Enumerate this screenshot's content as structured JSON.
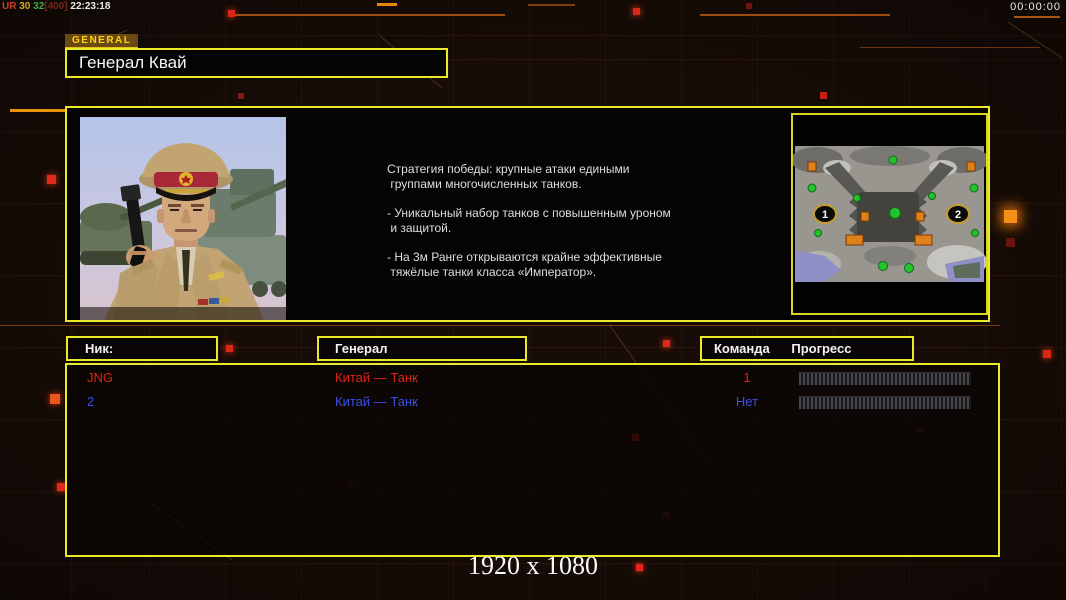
{
  "hud": {
    "debug_segments": [
      {
        "text": "UR ",
        "color": "#c83c28"
      },
      {
        "text": "30 ",
        "color": "#d8a828"
      },
      {
        "text": "32",
        "color": "#3fae3f"
      },
      {
        "text": "[400] ",
        "color": "#7a2418"
      },
      {
        "text": "22:23:18",
        "color": "#ececec"
      }
    ],
    "timer": "00:00:00"
  },
  "tab": {
    "label": "GENERAL"
  },
  "header": {
    "title": "Генерал Квай"
  },
  "info": {
    "description": [
      "Стратегия победы: крупные атаки едиными\n группами многочисленных танков.",
      "- Уникальный набор танков с повышенным уроном\n и защитой.",
      "- На 3м Ранге открываются крайне эффективные\n тяжёлые танки класса «Император»."
    ],
    "minimap": {
      "start_positions": [
        "1",
        "2"
      ]
    }
  },
  "table": {
    "headers": {
      "nick": "Ник:",
      "general": "Генерал",
      "team": "Команда",
      "progress": "Прогресс"
    },
    "rows": [
      {
        "nick": "JNG",
        "general": "Китай — Танк",
        "team": "1",
        "color": "#e02418"
      },
      {
        "nick": "2",
        "general": "Китай — Танк",
        "team": "Нет",
        "color": "#3a50e8"
      }
    ]
  },
  "footer": {
    "resolution": "1920 x 1080"
  },
  "theme": {
    "accent_yellow": "#eaea28",
    "accent_orange": "#e07818",
    "band_red": "#a82838"
  }
}
